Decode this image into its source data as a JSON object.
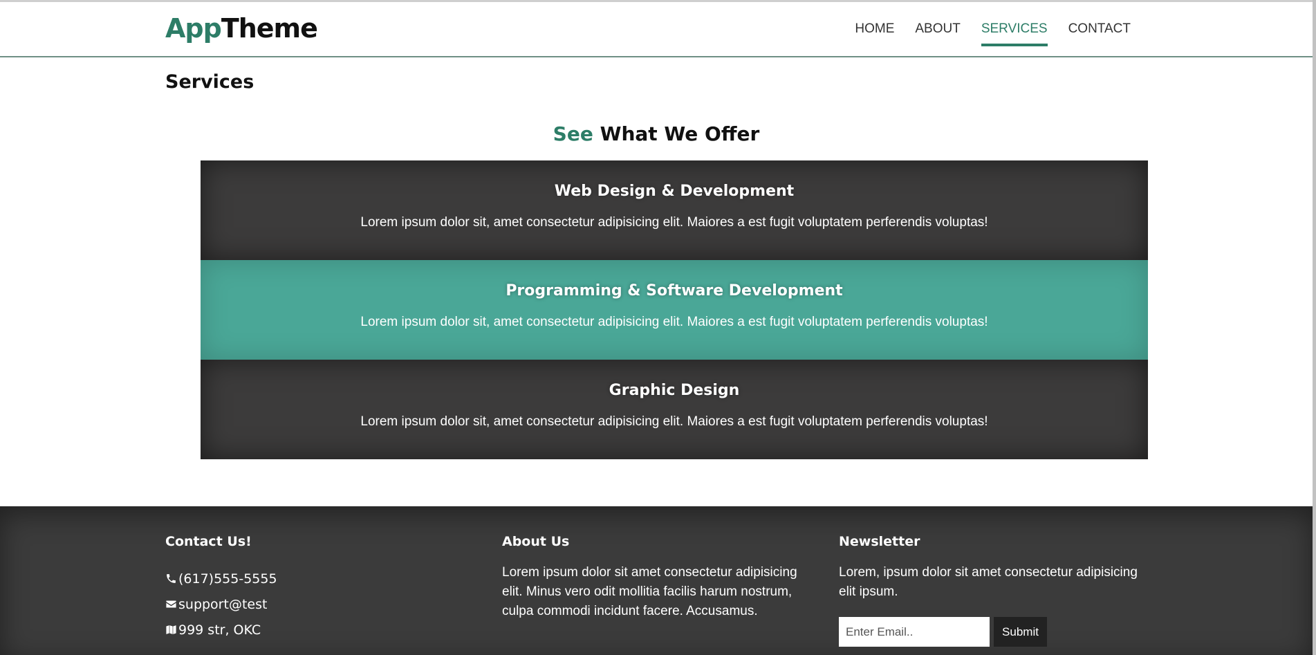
{
  "brand": {
    "part1": "App",
    "part2": "Theme"
  },
  "nav": {
    "items": [
      {
        "label": "HOME"
      },
      {
        "label": "ABOUT"
      },
      {
        "label": "SERVICES"
      },
      {
        "label": "CONTACT"
      }
    ],
    "active": "SERVICES"
  },
  "page": {
    "title": "Services"
  },
  "section": {
    "heading_accent": "See",
    "heading_rest": "What We Offer"
  },
  "services": [
    {
      "title": "Web Design & Development",
      "text": "Lorem ipsum dolor sit, amet consectetur adipisicing elit. Maiores a est fugit voluptatem perferendis voluptas!"
    },
    {
      "title": "Programming & Software Development",
      "text": "Lorem ipsum dolor sit, amet consectetur adipisicing elit. Maiores a est fugit voluptatem perferendis voluptas!"
    },
    {
      "title": "Graphic Design",
      "text": "Lorem ipsum dolor sit, amet consectetur adipisicing elit. Maiores a est fugit voluptatem perferendis voluptas!"
    }
  ],
  "footer": {
    "contact": {
      "heading": "Contact Us!",
      "phone": "(617)555-5555",
      "email": "support@test",
      "address": "999 str, OKC"
    },
    "about": {
      "heading": "About Us",
      "text": "Lorem ipsum dolor sit amet consectetur adipisicing elit. Minus vero odit mollitia facilis harum nostrum, culpa commodi incidunt facere. Accusamus."
    },
    "newsletter": {
      "heading": "Newsletter",
      "text": "Lorem, ipsum dolor sit amet consectetur adipisicing elit ipsum.",
      "email_placeholder": "Enter Email..",
      "email_value": "",
      "submit_label": "Submit"
    }
  },
  "colors": {
    "accent": "#2d7d67",
    "service_teal": "#4aa797",
    "service_dark": "#3c3b3b",
    "footer_bg": "#3b3b3b"
  },
  "icons": [
    "phone-icon",
    "envelope-icon",
    "map-icon"
  ]
}
